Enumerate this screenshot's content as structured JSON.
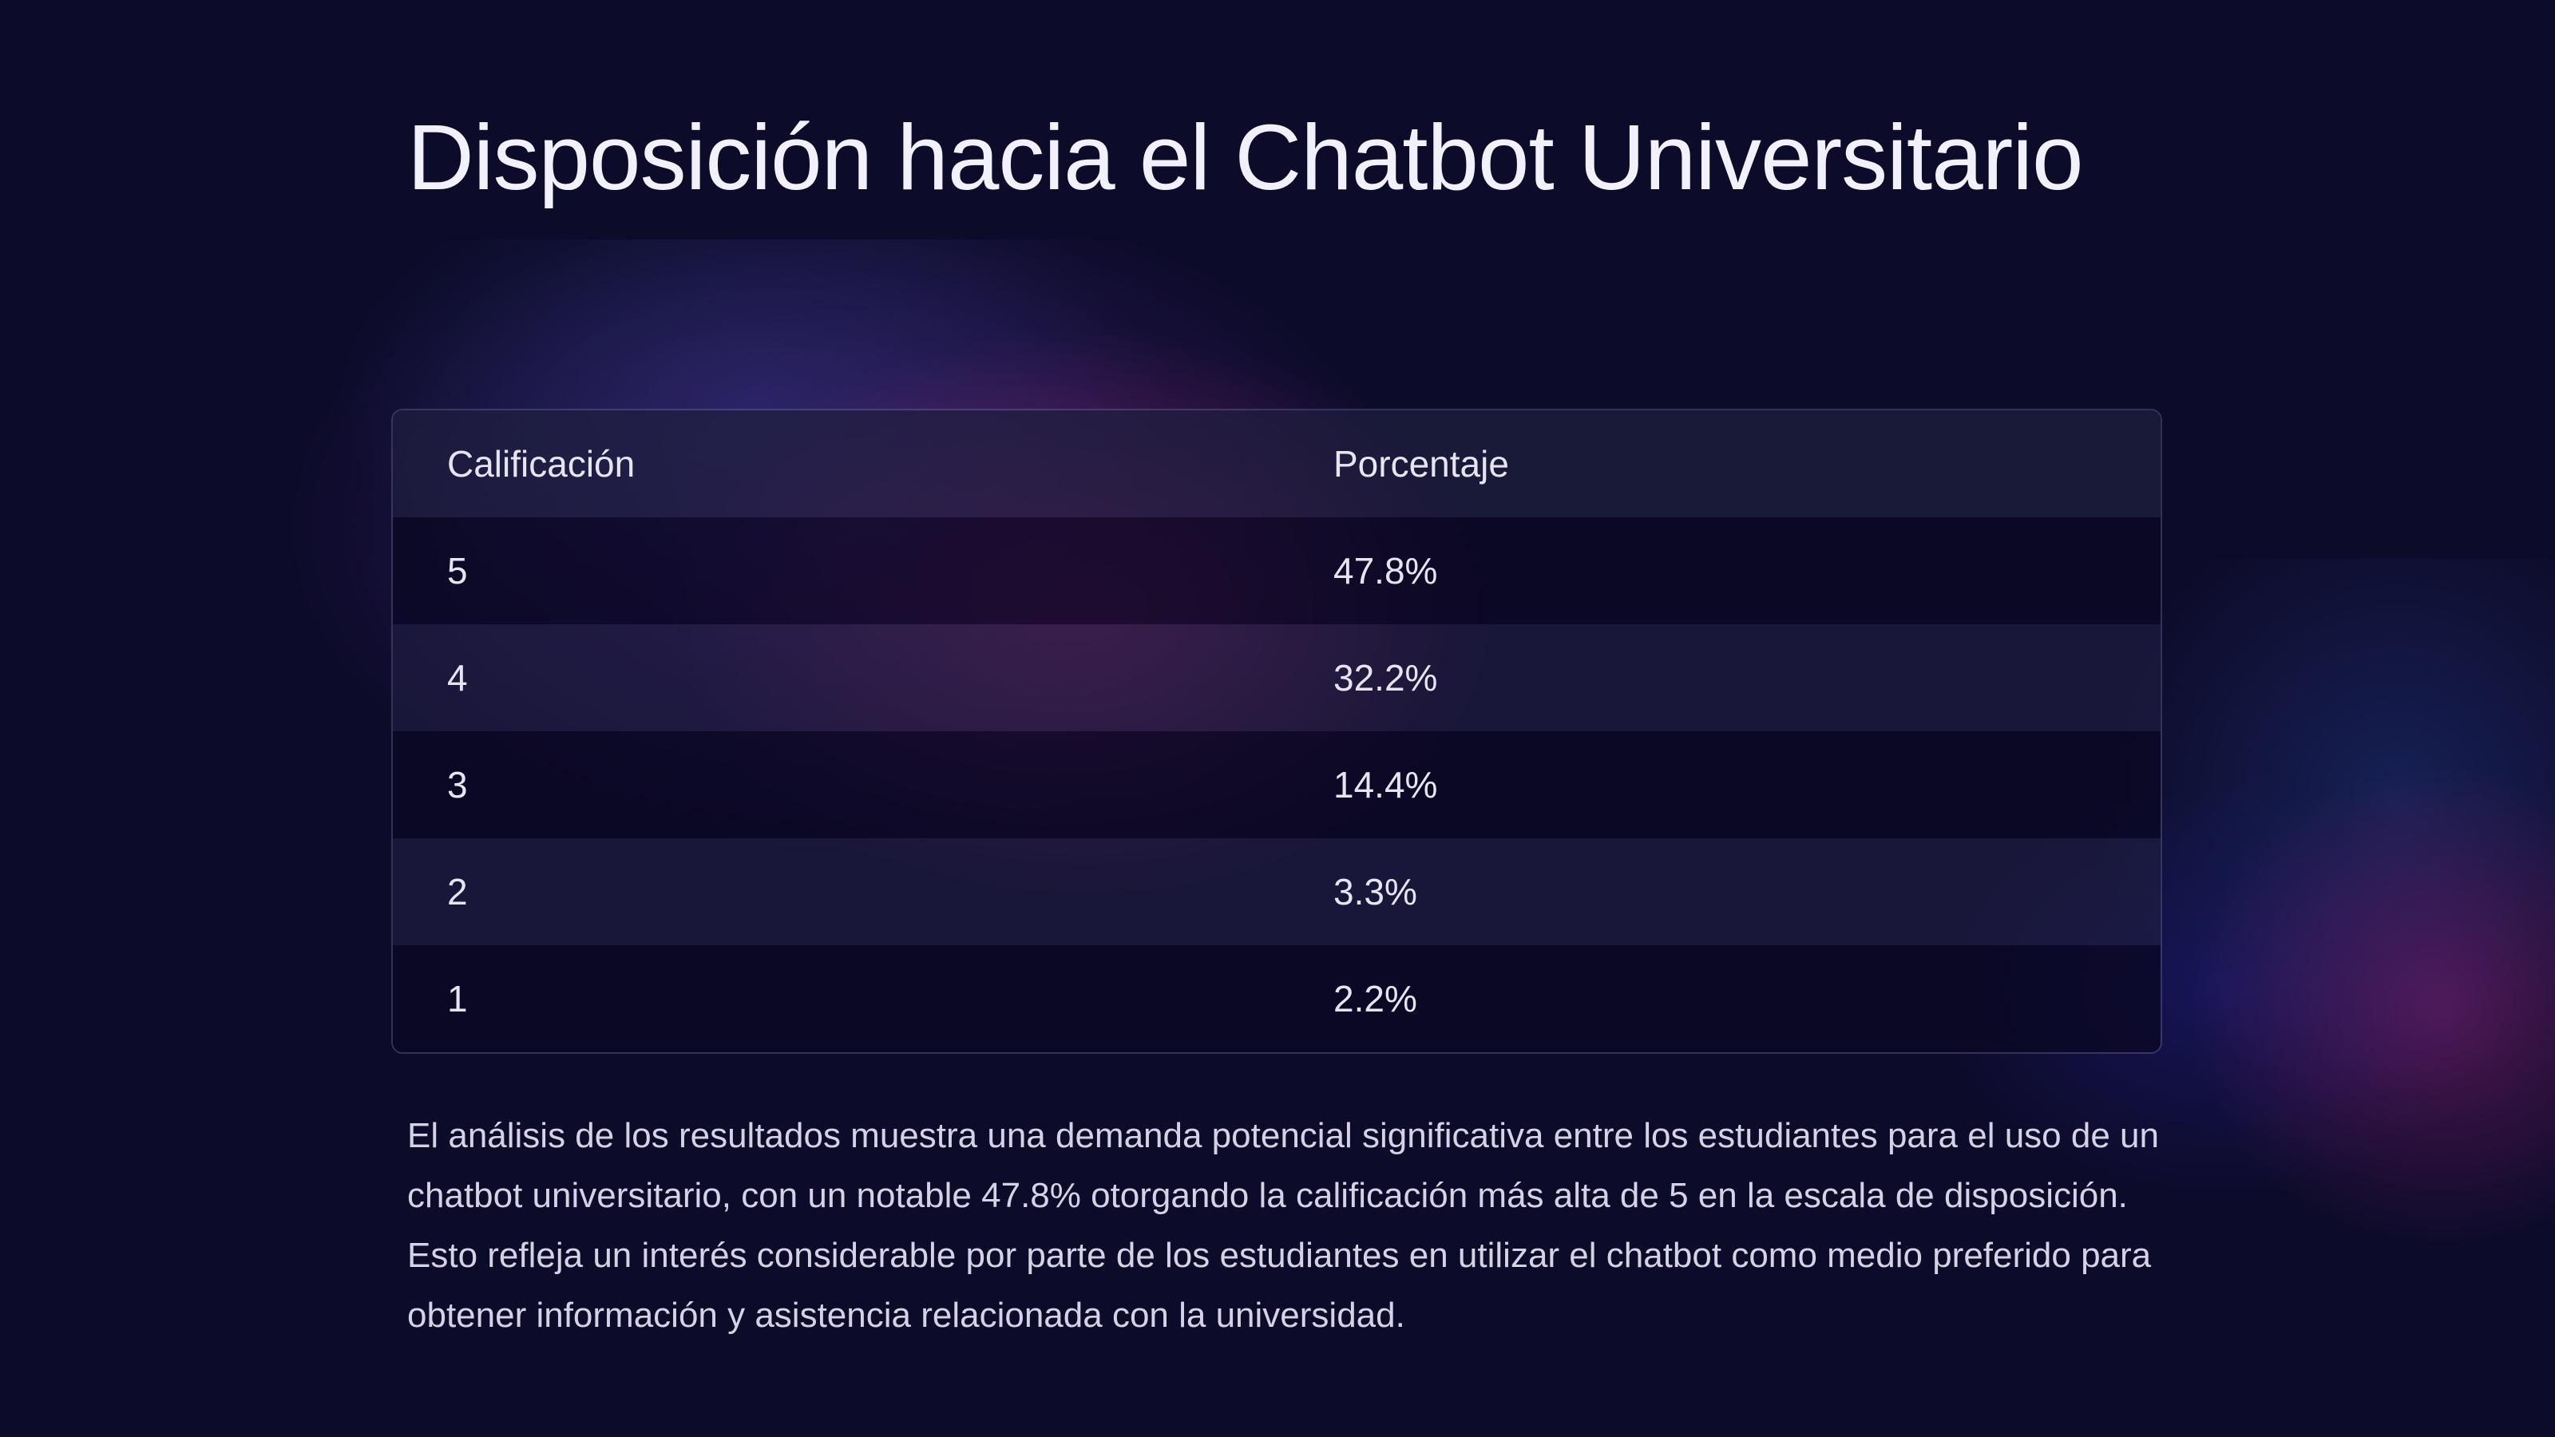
{
  "title": "Disposición hacia el Chatbot Universitario",
  "table": {
    "headers": [
      "Calificación",
      "Porcentaje"
    ],
    "rows": [
      [
        "5",
        "47.8%"
      ],
      [
        "4",
        "32.2%"
      ],
      [
        "3",
        "14.4%"
      ],
      [
        "2",
        "3.3%"
      ],
      [
        "1",
        "2.2%"
      ]
    ]
  },
  "summary": "El análisis de los resultados muestra una demanda potencial significativa entre los estudiantes para el uso de un chatbot universitario, con un notable 47.8% otorgando la calificación más alta de 5 en la escala de disposición. Esto refleja un interés considerable por parte de los estudiantes en utilizar el chatbot como medio preferido para obtener información y asistencia relacionada con la universidad.",
  "colors": {
    "background": "#0d0b2a",
    "text": "#f2f0fa",
    "glow_magenta": "#a0286e",
    "glow_blue": "#283c82"
  }
}
